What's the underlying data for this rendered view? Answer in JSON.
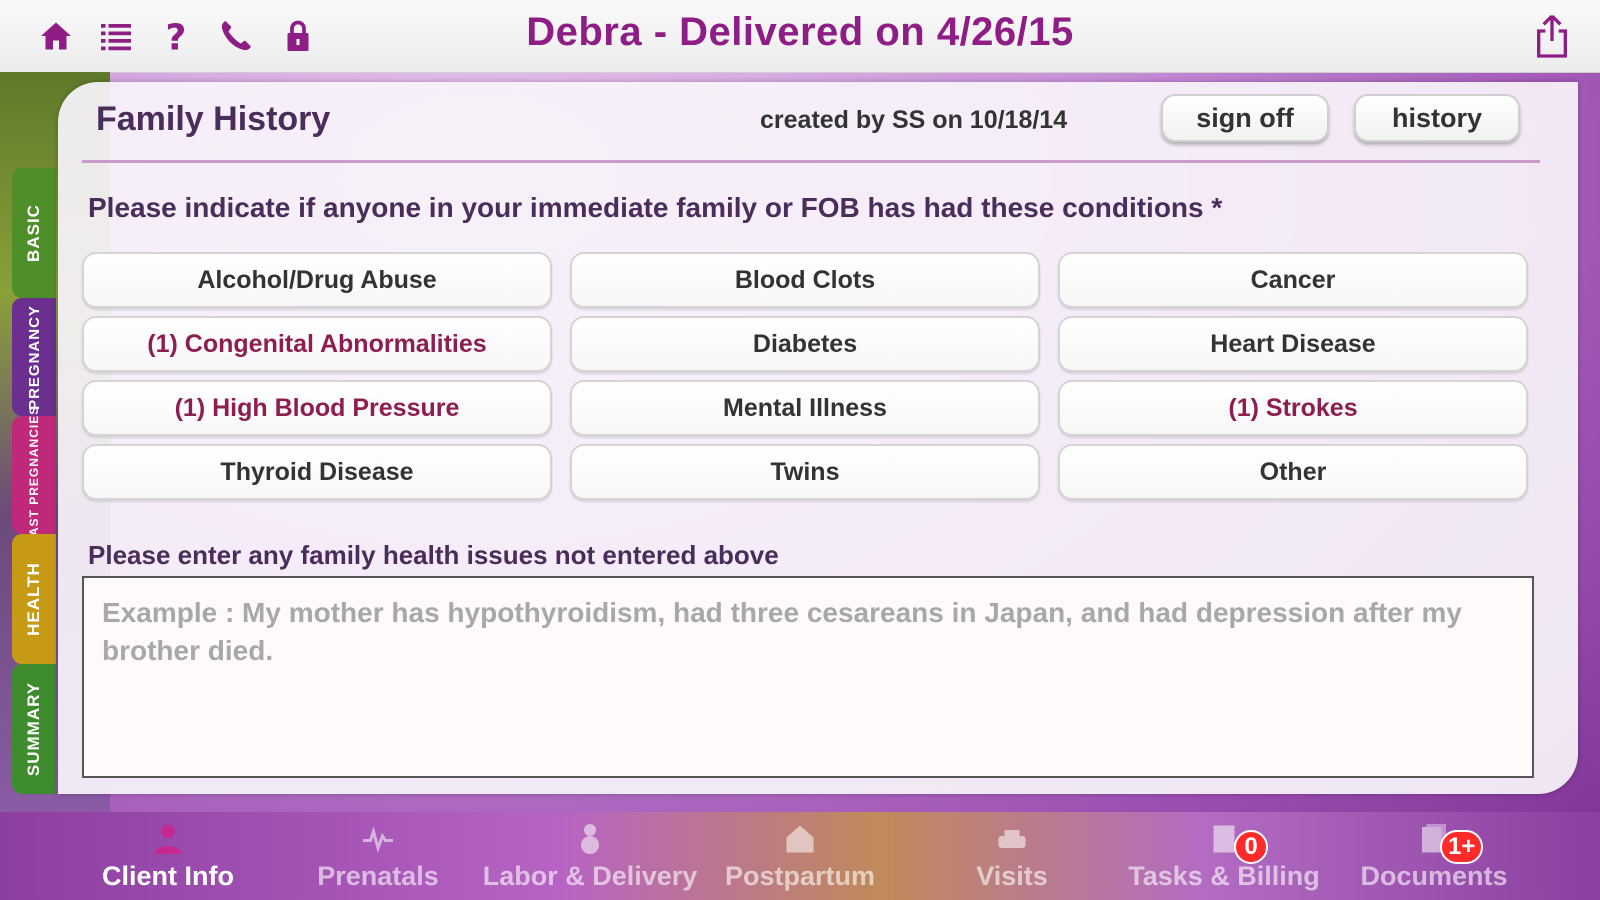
{
  "header": {
    "title": "Debra - Delivered on 4/26/15",
    "icons": [
      "home-icon",
      "list-icon",
      "help-icon",
      "phone-icon",
      "lock-icon",
      "share-icon"
    ],
    "accent_color": "#8e1d86"
  },
  "side_tabs": [
    {
      "label": "BASIC",
      "color": "#4f8f2a"
    },
    {
      "label": "PREGNANCY",
      "color": "#6a2f8f"
    },
    {
      "label": "PAST PREGNANCIES",
      "color": "#c0287a"
    },
    {
      "label": "HEALTH",
      "color": "#c79a15"
    },
    {
      "label": "SUMMARY",
      "color": "#3f8c2e"
    }
  ],
  "form": {
    "title": "Family History",
    "created": "created by SS on 10/18/14",
    "sign_off_label": "sign off",
    "history_label": "history",
    "question": "Please indicate if anyone in your immediate family or FOB has had these conditions *",
    "conditions": [
      {
        "label": "Alcohol/Drug Abuse",
        "selected": false
      },
      {
        "label": "Blood Clots",
        "selected": false
      },
      {
        "label": "Cancer",
        "selected": false
      },
      {
        "label": "(1) Congenital Abnormalities",
        "selected": true
      },
      {
        "label": "Diabetes",
        "selected": false
      },
      {
        "label": "Heart Disease",
        "selected": false
      },
      {
        "label": "(1) High Blood Pressure",
        "selected": true
      },
      {
        "label": "Mental Illness",
        "selected": false
      },
      {
        "label": "(1) Strokes",
        "selected": true
      },
      {
        "label": "Thyroid Disease",
        "selected": false
      },
      {
        "label": "Twins",
        "selected": false
      },
      {
        "label": "Other",
        "selected": false
      }
    ],
    "notes_label": "Please enter any family health issues not entered above",
    "notes_placeholder": "Example : My mother has hypothyroidism, had three cesareans in Japan, and had depression after my brother died."
  },
  "bottom_nav": [
    {
      "label": "Client Info",
      "icon": "person-icon",
      "active": true,
      "badge": ""
    },
    {
      "label": "Prenatals",
      "icon": "heartbeat-icon",
      "active": false,
      "badge": ""
    },
    {
      "label": "Labor & Delivery",
      "icon": "baby-icon",
      "active": false,
      "badge": ""
    },
    {
      "label": "Postpartum",
      "icon": "house-icon",
      "active": false,
      "badge": ""
    },
    {
      "label": "Visits",
      "icon": "car-icon",
      "active": false,
      "badge": ""
    },
    {
      "label": "Tasks & Billing",
      "icon": "tasks-icon",
      "active": false,
      "badge": "0"
    },
    {
      "label": "Documents",
      "icon": "documents-icon",
      "active": false,
      "badge": "1+"
    }
  ]
}
